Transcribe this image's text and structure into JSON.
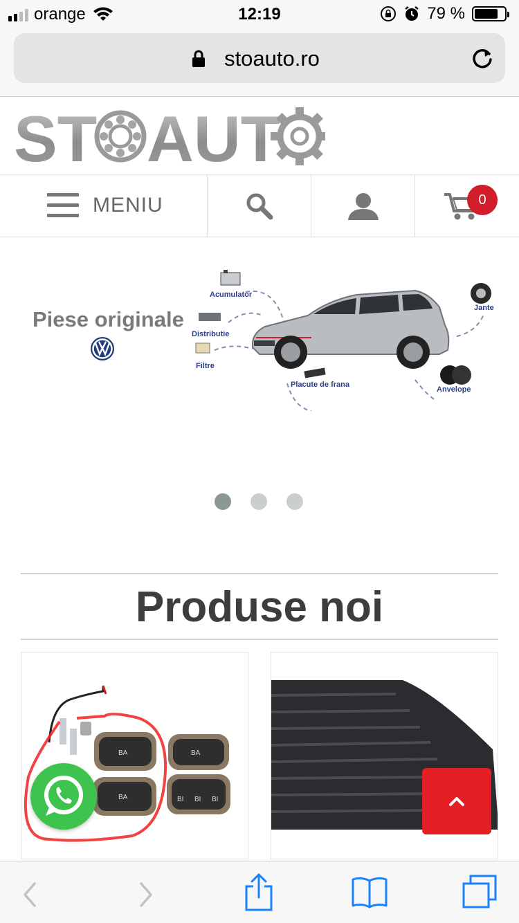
{
  "status_bar": {
    "carrier": "orange",
    "time": "12:19",
    "battery_percent": "79 %",
    "battery_level": 0.79,
    "signal_bars_active": 2
  },
  "browser": {
    "url": "stoauto.ro"
  },
  "site": {
    "logo_text": "STOAUTO"
  },
  "nav": {
    "menu_label": "MENIU",
    "cart_count": "0"
  },
  "banner": {
    "title": "Piese originale",
    "labels": {
      "acumulator": "Acumulator",
      "distributie": "Distributie",
      "filtre": "Filtre",
      "placute": "Placute de frana",
      "jante": "Jante",
      "anvelope": "Anvelope"
    },
    "slides": 3,
    "active_slide": 1
  },
  "section": {
    "title": "Produse noi"
  },
  "colors": {
    "accent_red": "#e31e24",
    "badge_red": "#d11e2a",
    "whatsapp_green": "#3fc34f",
    "ios_blue": "#1a82fb"
  }
}
